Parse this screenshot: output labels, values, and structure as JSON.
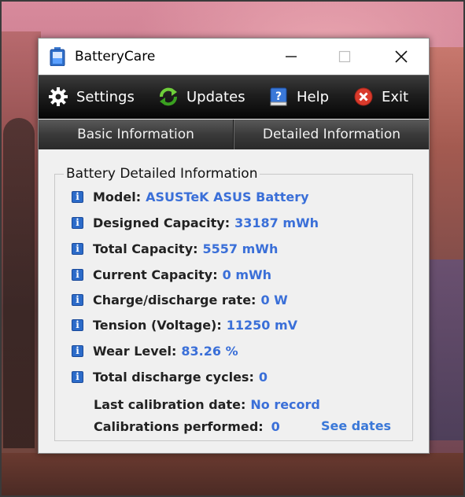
{
  "window": {
    "title": "BatteryCare",
    "controls": {
      "minimize": "—",
      "maximize": "☐",
      "close": "✕"
    }
  },
  "toolbar": {
    "items": [
      {
        "label": "Settings",
        "icon": "gear-icon"
      },
      {
        "label": "Updates",
        "icon": "refresh-icon"
      },
      {
        "label": "Help",
        "icon": "help-book-icon"
      },
      {
        "label": "Exit",
        "icon": "exit-icon"
      }
    ]
  },
  "tabs": [
    {
      "label": "Basic Information"
    },
    {
      "label": "Detailed Information"
    }
  ],
  "details": {
    "group_title": "Battery Detailed Information",
    "rows": [
      {
        "label": "Model:",
        "value": "ASUSTeK ASUS Battery"
      },
      {
        "label": "Designed Capacity:",
        "value": "33187 mWh"
      },
      {
        "label": "Total Capacity:",
        "value": "5557 mWh"
      },
      {
        "label": "Current Capacity:",
        "value": "0 mWh"
      },
      {
        "label": "Charge/discharge rate:",
        "value": "0 W"
      },
      {
        "label": "Tension (Voltage):",
        "value": "11250 mV"
      },
      {
        "label": "Wear Level:",
        "value": "83.26 %"
      },
      {
        "label": "Total discharge cycles:",
        "value": "0"
      }
    ],
    "calibration": {
      "last_label": "Last calibration date:",
      "last_value": "No record",
      "performed_label": "Calibrations performed:",
      "performed_value": "0",
      "see_dates": "See dates"
    }
  },
  "colors": {
    "value_blue": "#3a6fd8",
    "info_icon_blue": "#2c6bc9",
    "exit_red": "#d93a2b"
  }
}
